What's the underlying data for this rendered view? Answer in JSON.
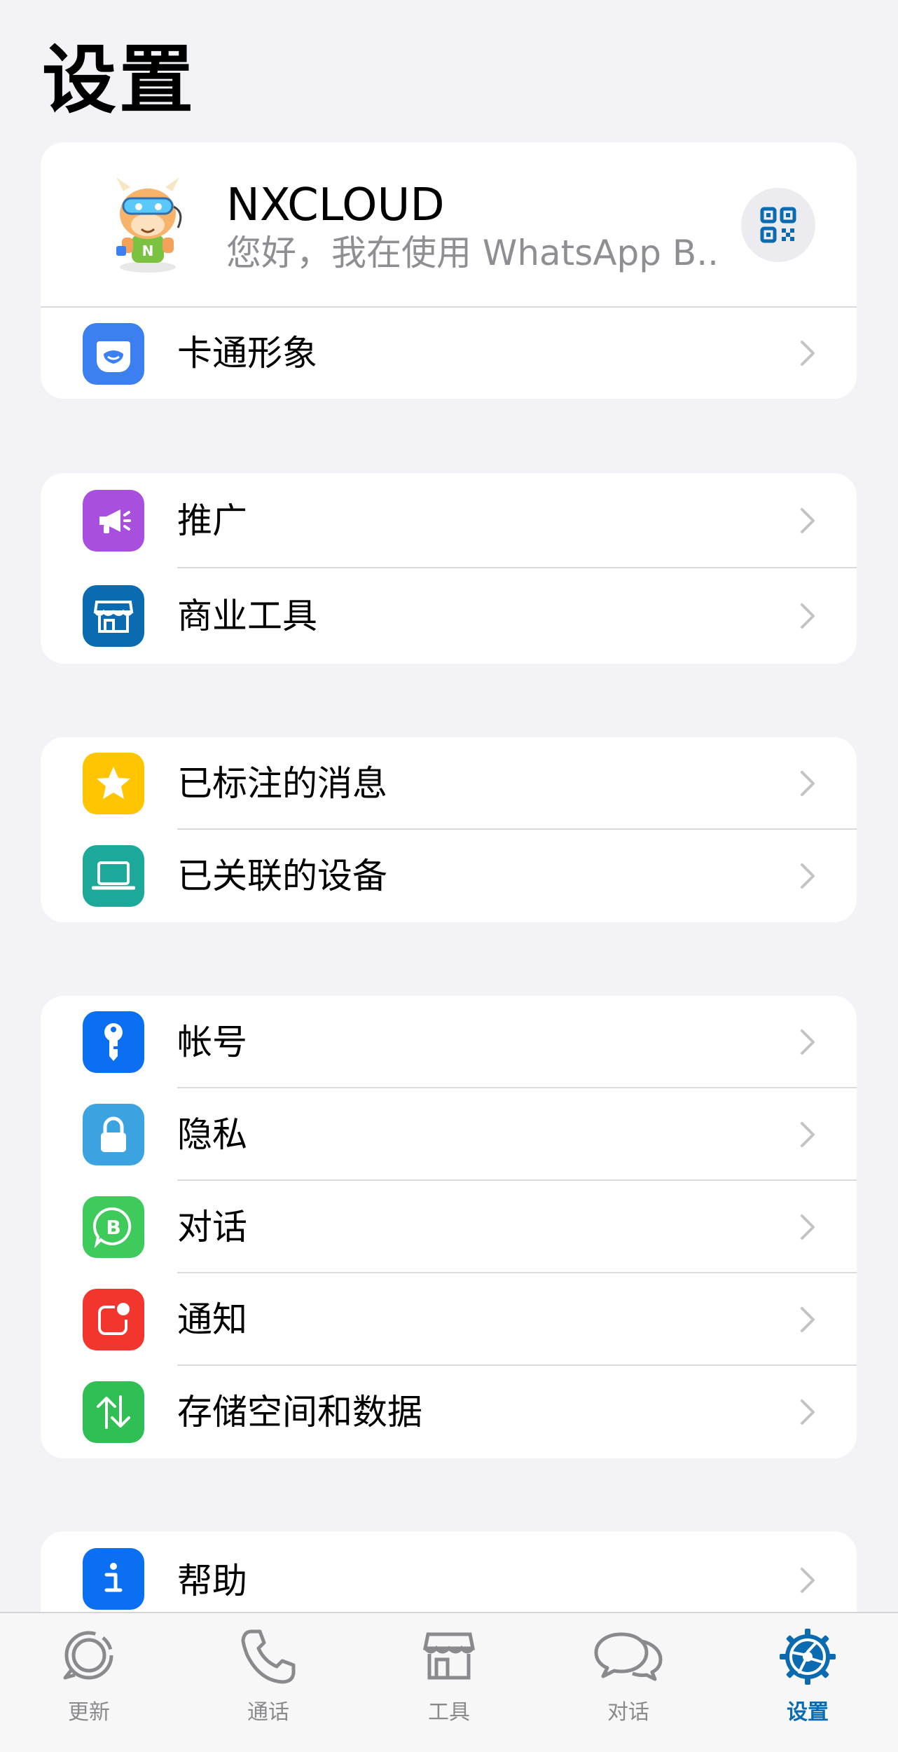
{
  "page": {
    "title": "设置"
  },
  "profile": {
    "name": "NXCLOUD",
    "status": "您好，我在使用 WhatsApp B..."
  },
  "groups": {
    "g1": {
      "avatar_item": "卡通形象"
    },
    "g2": {
      "promote": "推广",
      "business_tools": "商业工具"
    },
    "g3": {
      "starred": "已标注的消息",
      "linked_devices": "已关联的设备"
    },
    "g4": {
      "account": "帐号",
      "privacy": "隐私",
      "chats": "对话",
      "notifications": "通知",
      "storage": "存储空间和数据"
    },
    "g5": {
      "help": "帮助"
    }
  },
  "icon_colors": {
    "avatar": "#3b7ff0",
    "promote": "#a94fe0",
    "business_tools": "#0a6bb0",
    "starred": "#fec500",
    "linked_devices": "#1ca99a",
    "account": "#0a6ff0",
    "privacy": "#3aa3e0",
    "chats": "#3fcb5b",
    "notifications": "#f2362d",
    "storage": "#2fbf55",
    "help": "#0a6ff0"
  },
  "tabbar": {
    "updates": "更新",
    "calls": "通话",
    "tools": "工具",
    "chats": "对话",
    "settings": "设置",
    "active": "settings",
    "active_color": "#0a6bb0"
  }
}
